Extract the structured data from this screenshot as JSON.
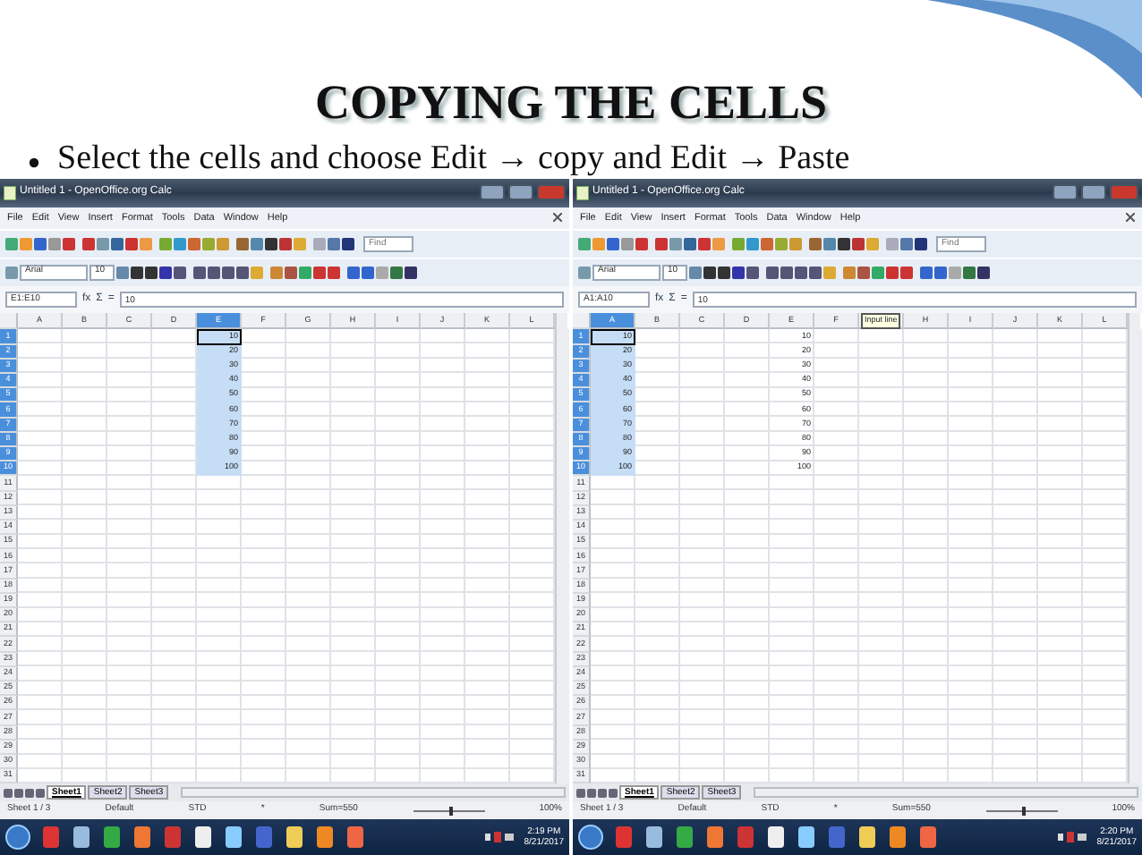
{
  "slide": {
    "title": "COPYING THE CELLS",
    "bullet": "Select the cells and choose Edit → copy and Edit → Paste"
  },
  "windows": [
    {
      "title": "Untitled 1 - OpenOffice.org Calc",
      "menu": [
        "File",
        "Edit",
        "View",
        "Insert",
        "Format",
        "Tools",
        "Data",
        "Window",
        "Help"
      ],
      "find": {
        "placeholder": "Find"
      },
      "font_name": "Arial",
      "font_size": "10",
      "name_box": "E1:E10",
      "formula_buttons": [
        "fx",
        "Σ",
        "="
      ],
      "formula": "10",
      "columns": [
        {
          "label": "A",
          "selected": false
        },
        {
          "label": "B",
          "selected": false
        },
        {
          "label": "C",
          "selected": false
        },
        {
          "label": "D",
          "selected": false
        },
        {
          "label": "E",
          "selected": true,
          "values": [
            "10",
            "20",
            "30",
            "40",
            "50",
            "60",
            "70",
            "80",
            "90",
            "100"
          ]
        },
        {
          "label": "F",
          "selected": false
        },
        {
          "label": "G",
          "selected": false
        },
        {
          "label": "H",
          "selected": false
        },
        {
          "label": "I",
          "selected": false
        },
        {
          "label": "J",
          "selected": false
        },
        {
          "label": "K",
          "selected": false
        },
        {
          "label": "L",
          "selected": false
        }
      ],
      "rows": [
        {
          "label": "1",
          "selected": true
        },
        {
          "label": "2",
          "selected": true
        },
        {
          "label": "3",
          "selected": true
        },
        {
          "label": "4",
          "selected": true
        },
        {
          "label": "5",
          "selected": true
        },
        {
          "label": "6",
          "selected": true
        },
        {
          "label": "7",
          "selected": true
        },
        {
          "label": "8",
          "selected": true
        },
        {
          "label": "9",
          "selected": true
        },
        {
          "label": "10",
          "selected": true
        },
        {
          "label": "11",
          "selected": false
        },
        {
          "label": "12",
          "selected": false
        },
        {
          "label": "13",
          "selected": false
        },
        {
          "label": "14",
          "selected": false
        },
        {
          "label": "15",
          "selected": false
        },
        {
          "label": "16",
          "selected": false
        },
        {
          "label": "17",
          "selected": false
        },
        {
          "label": "18",
          "selected": false
        },
        {
          "label": "19",
          "selected": false
        },
        {
          "label": "20",
          "selected": false
        },
        {
          "label": "21",
          "selected": false
        },
        {
          "label": "22",
          "selected": false
        },
        {
          "label": "23",
          "selected": false
        },
        {
          "label": "24",
          "selected": false
        },
        {
          "label": "25",
          "selected": false
        },
        {
          "label": "26",
          "selected": false
        },
        {
          "label": "27",
          "selected": false
        },
        {
          "label": "28",
          "selected": false
        },
        {
          "label": "29",
          "selected": false
        },
        {
          "label": "30",
          "selected": false
        },
        {
          "label": "31",
          "selected": false
        }
      ],
      "sheet_tabs": [
        {
          "label": "Sheet1",
          "selected": true
        },
        {
          "label": "Sheet2",
          "selected": false
        },
        {
          "label": "Sheet3",
          "selected": false
        }
      ],
      "status_bar": {
        "sheet": "Sheet 1 / 3",
        "style": "Default",
        "mode": "STD",
        "modified": "*",
        "sum": "Sum=550",
        "zoom": {
          "level": 0.5
        },
        "zoom_text": "100%"
      },
      "taskbar": {
        "time": "2:19 PM",
        "date": "8/21/2017"
      }
    },
    {
      "title": "Untitled 1 - OpenOffice.org Calc",
      "menu": [
        "File",
        "Edit",
        "View",
        "Insert",
        "Format",
        "Tools",
        "Data",
        "Window",
        "Help"
      ],
      "find": {
        "placeholder": "Find"
      },
      "font_name": "Arial",
      "font_size": "10",
      "name_box": "A1:A10",
      "formula_buttons": [
        "fx",
        "Σ",
        "="
      ],
      "formula": "10",
      "tooltip": "Input line",
      "columns": [
        {
          "label": "A",
          "selected": true,
          "values": [
            "10",
            "20",
            "30",
            "40",
            "50",
            "60",
            "70",
            "80",
            "90",
            "100"
          ]
        },
        {
          "label": "B",
          "selected": false
        },
        {
          "label": "C",
          "selected": false
        },
        {
          "label": "D",
          "selected": false
        },
        {
          "label": "E",
          "selected": false,
          "values": [
            "10",
            "20",
            "30",
            "40",
            "50",
            "60",
            "70",
            "80",
            "90",
            "100"
          ]
        },
        {
          "label": "F",
          "selected": false
        },
        {
          "selected": false
        },
        {
          "label": "H",
          "selected": false
        },
        {
          "label": "I",
          "selected": false
        },
        {
          "label": "J",
          "selected": false
        },
        {
          "label": "K",
          "selected": false
        },
        {
          "label": "L",
          "selected": false
        }
      ],
      "rows": [
        {
          "label": "1",
          "selected": true
        },
        {
          "label": "2",
          "selected": true
        },
        {
          "label": "3",
          "selected": true
        },
        {
          "label": "4",
          "selected": true
        },
        {
          "label": "5",
          "selected": true
        },
        {
          "label": "6",
          "selected": true
        },
        {
          "label": "7",
          "selected": true
        },
        {
          "label": "8",
          "selected": true
        },
        {
          "label": "9",
          "selected": true
        },
        {
          "label": "10",
          "selected": true
        },
        {
          "label": "11",
          "selected": false
        },
        {
          "label": "12",
          "selected": false
        },
        {
          "label": "13",
          "selected": false
        },
        {
          "label": "14",
          "selected": false
        },
        {
          "label": "15",
          "selected": false
        },
        {
          "label": "16",
          "selected": false
        },
        {
          "label": "17",
          "selected": false
        },
        {
          "label": "18",
          "selected": false
        },
        {
          "label": "19",
          "selected": false
        },
        {
          "label": "20",
          "selected": false
        },
        {
          "label": "21",
          "selected": false
        },
        {
          "label": "22",
          "selected": false
        },
        {
          "label": "23",
          "selected": false
        },
        {
          "label": "24",
          "selected": false
        },
        {
          "label": "25",
          "selected": false
        },
        {
          "label": "26",
          "selected": false
        },
        {
          "label": "27",
          "selected": false
        },
        {
          "label": "28",
          "selected": false
        },
        {
          "label": "29",
          "selected": false
        },
        {
          "label": "30",
          "selected": false
        },
        {
          "label": "31",
          "selected": false
        }
      ],
      "sheet_tabs": [
        {
          "label": "Sheet1",
          "selected": true
        },
        {
          "label": "Sheet2",
          "selected": false
        },
        {
          "label": "Sheet3",
          "selected": false
        }
      ],
      "status_bar": {
        "sheet": "Sheet 1 / 3",
        "style": "Default",
        "mode": "STD",
        "modified": "*",
        "sum": "Sum=550",
        "zoom": {
          "level": 0.5
        },
        "zoom_text": "100%"
      },
      "taskbar": {
        "time": "2:20 PM",
        "date": "8/21/2017"
      }
    }
  ]
}
